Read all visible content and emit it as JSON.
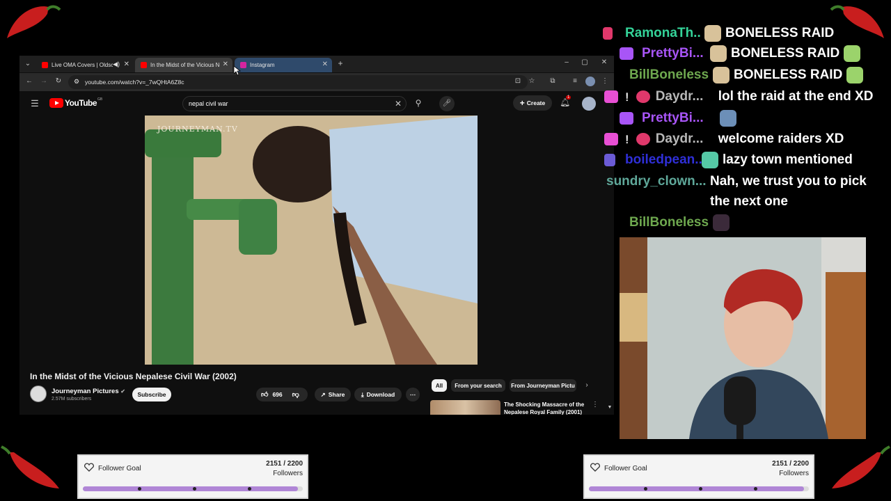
{
  "browser": {
    "tabs": [
      {
        "title": "Live OMA Covers | Oldschool",
        "favicon_color": "#ff0000"
      },
      {
        "title": "In the Midst of the Vicious Nep",
        "favicon_color": "#ff0000"
      },
      {
        "title": "Instagram",
        "favicon_color": "#d6249f"
      }
    ],
    "url": "youtube.com/watch?v=_7wQHtA6Z8c"
  },
  "youtube": {
    "logo_text": "YouTube",
    "logo_country": "GB",
    "search_value": "nepal civil war",
    "create_label": "Create",
    "notification_count": "1",
    "video_watermark": "JOURNEYMAN.TV",
    "video_title": "In the Midst of the Vicious Nepalese Civil War (2002)",
    "channel_name": "Journeyman Pictures",
    "channel_subs": "2.57M subscribers",
    "subscribe_label": "Subscribe",
    "likes": "696",
    "share_label": "Share",
    "download_label": "Download",
    "chips": [
      "All",
      "From your search",
      "From Journeyman Pictu"
    ],
    "rec_title": "The Shocking Massacre of the Nepalese Royal Family (2001)"
  },
  "chat": [
    {
      "user": "RamonaTh...",
      "user_color": "#34d399",
      "message": "BONELESS RAID"
    },
    {
      "user": "PrettyBi...",
      "user_color": "#a855f7",
      "message": "BONELESS RAID"
    },
    {
      "user": "BillBoneless",
      "user_color": "#6ea84f",
      "message": "BONELESS RAID"
    },
    {
      "user": "Daydr...",
      "user_color": "#b7b7b7",
      "message": "lol the raid at the end XD"
    },
    {
      "user": "PrettyBi...",
      "user_color": "#a855f7",
      "message": ""
    },
    {
      "user": "Daydr...",
      "user_color": "#b7b7b7",
      "message": "welcome raiders XD"
    },
    {
      "user": "boiledpean...",
      "user_color": "#2f2fd8",
      "message": "lazy town mentioned"
    },
    {
      "user": "sundry_clown...",
      "user_color": "#5fa89a",
      "message": "Nah, we trust you to pick"
    },
    {
      "user": "",
      "user_color": "#ffffff",
      "message": "the next one"
    },
    {
      "user": "BillBoneless",
      "user_color": "#6ea84f",
      "message": ""
    }
  ],
  "goals": [
    {
      "label": "Follower Goal",
      "current": 2151,
      "target": 2200,
      "count_text": "2151 / 2200",
      "unit": "Followers",
      "progress": 0.978
    },
    {
      "label": "Follower Goal",
      "current": 2151,
      "target": 2200,
      "count_text": "2151 / 2200",
      "unit": "Followers",
      "progress": 0.978
    }
  ],
  "colors": {
    "accent": "#b086d6",
    "youtube_red": "#ff0000",
    "chili": "#c81e1e"
  }
}
